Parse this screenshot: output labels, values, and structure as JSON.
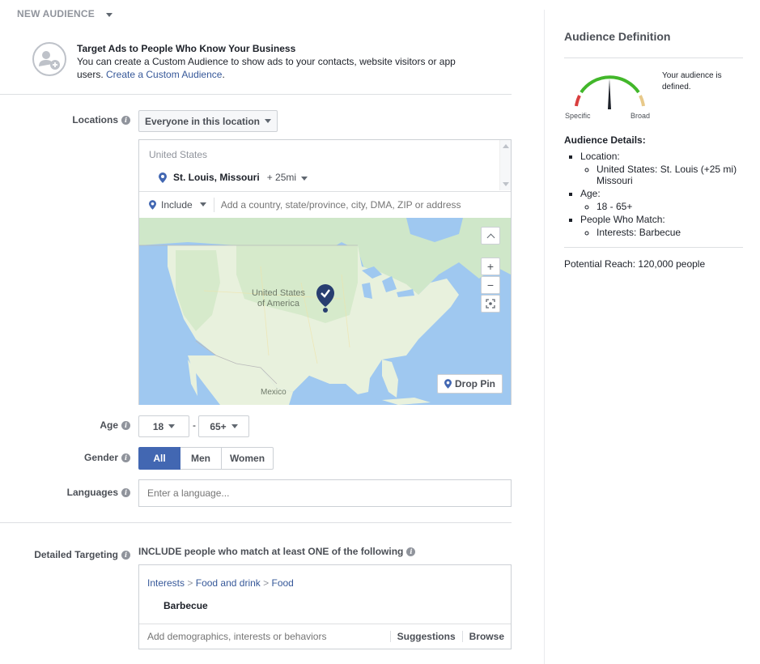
{
  "header": {
    "title": "NEW AUDIENCE"
  },
  "promo": {
    "title": "Target Ads to People Who Know Your Business",
    "body": "You can create a Custom Audience to show ads to your contacts, website visitors or app users. ",
    "link": "Create a Custom Audience",
    "link_suffix": "."
  },
  "locations": {
    "label": "Locations",
    "dropdown": "Everyone in this location",
    "country": "United States",
    "city": "St. Louis, Missouri",
    "radius": "+ 25mi",
    "include_label": "Include",
    "search_placeholder": "Add a country, state/province, city, DMA, ZIP or address",
    "map_label_1": "United States",
    "map_label_2": "of America",
    "map_label_mexico": "Mexico",
    "drop_pin": "Drop Pin"
  },
  "age": {
    "label": "Age",
    "min": "18",
    "max": "65+",
    "separator": "-"
  },
  "gender": {
    "label": "Gender",
    "options": [
      "All",
      "Men",
      "Women"
    ],
    "selected": "All"
  },
  "languages": {
    "label": "Languages",
    "placeholder": "Enter a language..."
  },
  "targeting": {
    "label": "Detailed Targeting",
    "description": "INCLUDE people who match at least ONE of the following",
    "breadcrumb": [
      "Interests",
      "Food and drink",
      "Food"
    ],
    "breadcrumb_sep": ">",
    "item": "Barbecue",
    "search_placeholder": "Add demographics, interests or behaviors",
    "suggestions": "Suggestions",
    "browse": "Browse"
  },
  "sidebar": {
    "title": "Audience Definition",
    "gauge_left": "Specific",
    "gauge_right": "Broad",
    "gauge_level": 0.5,
    "gauge_text": "Your audience is defined.",
    "details_title": "Audience Details:",
    "location_label": "Location:",
    "location_value": "United States: St. Louis (+25 mi) Missouri",
    "age_label": "Age:",
    "age_value": "18 - 65+",
    "match_label": "People Who Match:",
    "match_value": "Interests: Barbecue",
    "reach": "Potential Reach: 120,000 people"
  },
  "colors": {
    "accent": "#4267b2",
    "link": "#365899",
    "gauge_green": "#42b72a",
    "gauge_red": "#d93f3f",
    "gauge_tan": "#e8c98a"
  }
}
